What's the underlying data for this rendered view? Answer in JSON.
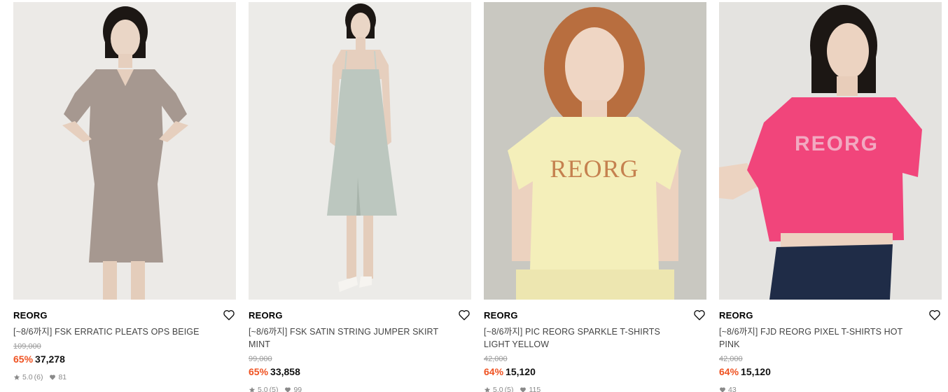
{
  "products": [
    {
      "brand": "REORG",
      "title": "[~8/6까지] FSK ERRATIC PLEATS OPS BEIGE",
      "original_price": "109,000",
      "discount": "65%",
      "price": "37,278",
      "rating": "5.0",
      "reviews": "(6)",
      "likes": "81",
      "image": "model-in-beige-pleated-dress"
    },
    {
      "brand": "REORG",
      "title": "[~8/6까지] FSK SATIN STRING JUMPER SKIRT MINT",
      "original_price": "99,000",
      "discount": "65%",
      "price": "33,858",
      "rating": "5.0",
      "reviews": "(5)",
      "likes": "99",
      "image": "model-in-mint-satin-slip-dress"
    },
    {
      "brand": "REORG",
      "title": "[~8/6까지] PIC REORG SPARKLE T-SHIRTS LIGHT YELLOW",
      "original_price": "42,000",
      "discount": "64%",
      "price": "15,120",
      "rating": "5.0",
      "reviews": "(5)",
      "likes": "115",
      "image": "model-in-light-yellow-tshirt",
      "print": "REORG"
    },
    {
      "brand": "REORG",
      "title": "[~8/6까지] FJD REORG PIXEL T-SHIRTS HOT PINK",
      "original_price": "42,000",
      "discount": "64%",
      "price": "15,120",
      "likes": "43",
      "image": "model-in-hot-pink-tshirt",
      "print": "REORG"
    }
  ],
  "colors": {
    "discount": "#ef5221",
    "meta": "#8a8a8a"
  },
  "icons": {
    "wishlist": "heart-outline-icon",
    "rating": "star-icon",
    "likes": "heart-filled-icon"
  }
}
